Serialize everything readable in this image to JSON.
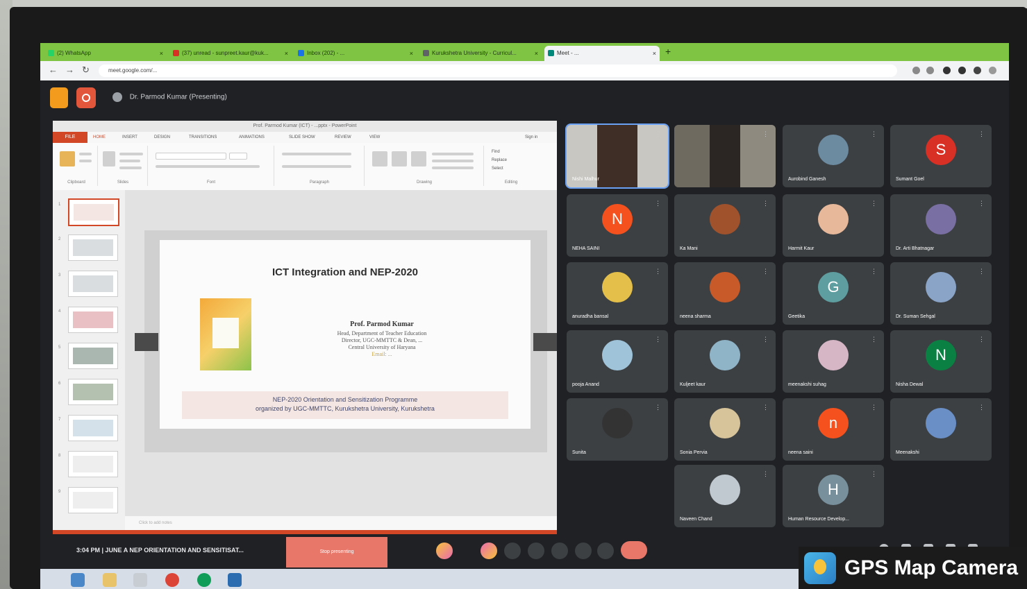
{
  "browser": {
    "tabs": [
      {
        "label": "(2) WhatsApp",
        "color": "#25d366"
      },
      {
        "label": "(37) unread - sunpreet.kaur@kuk...",
        "color": "#d93025"
      },
      {
        "label": "Inbox (202) - ...",
        "color": "#1a73e8"
      },
      {
        "label": "Kurukshetra University - Curricul...",
        "color": "#5f6368"
      },
      {
        "label": "Meet - ...",
        "color": "#00897b",
        "active": true
      }
    ],
    "new_tab": "+",
    "url": "meet.google.com/..."
  },
  "meet": {
    "presenter_label": "Dr. Parmod Kumar (Presenting)",
    "bottom_info": "3:04 PM  |  JUNE A NEP ORIENTATION AND SENSITISAT...",
    "present_now": "Stop presenting"
  },
  "powerpoint": {
    "window_title": "Prof. Parmod Kumar (ICT) - ...pptx - PowerPoint",
    "file_tab": "FILE",
    "tabs": [
      "HOME",
      "INSERT",
      "DESIGN",
      "TRANSITIONS",
      "ANIMATIONS",
      "SLIDE SHOW",
      "REVIEW",
      "VIEW"
    ],
    "sign_in": "Sign in",
    "ribbon_groups": [
      "Clipboard",
      "Slides",
      "Font",
      "Paragraph",
      "Drawing",
      "Editing"
    ],
    "ribbon_editing": [
      "Find",
      "Replace",
      "Select"
    ],
    "thumbnail_numbers": [
      "1",
      "2",
      "3",
      "4",
      "5",
      "6",
      "7",
      "8",
      "9"
    ],
    "notes_placeholder": "Click to add notes",
    "slide": {
      "title": "ICT Integration and NEP-2020",
      "speaker": "Prof. Parmod Kumar",
      "details": [
        "Head, Department of Teacher Education",
        "Director, UGC-MMTTC & Dean, ...",
        "Central University of Haryana",
        "Email: ..."
      ],
      "footer_line1": "NEP-2020 Orientation and Sensitization Programme",
      "footer_line2": "organized by UGC-MMTTC, Kurukshetra University, Kurukshetra"
    }
  },
  "participants": [
    {
      "name": "Nishi Malhur",
      "type": "video",
      "speaking": true
    },
    {
      "name": "",
      "type": "video"
    },
    {
      "name": "Aurobind Ganesh",
      "type": "photo",
      "color": "#6c8aa0"
    },
    {
      "name": "Sumant Goel",
      "type": "letter",
      "letter": "S",
      "color": "#d93025"
    },
    {
      "name": "NEHA SAINI",
      "type": "letter",
      "letter": "N",
      "color": "#f4511e"
    },
    {
      "name": "Ka Mani",
      "type": "photo",
      "color": "#a0522d"
    },
    {
      "name": "Harmit Kaur",
      "type": "photo",
      "color": "#e8b89a"
    },
    {
      "name": "Dr. Arti Bhatnagar",
      "type": "photo",
      "color": "#7a6fa3"
    },
    {
      "name": "anuradha bansal",
      "type": "photo",
      "color": "#e4c04a"
    },
    {
      "name": "neena sharma",
      "type": "photo",
      "color": "#c85a2a"
    },
    {
      "name": "Geetika",
      "type": "letter",
      "letter": "G",
      "color": "#5f9ea0"
    },
    {
      "name": "Dr. Suman Sehgal",
      "type": "photo",
      "color": "#8aa4c8"
    },
    {
      "name": "pooja Anand",
      "type": "photo",
      "color": "#9fc3d9"
    },
    {
      "name": "Kuljeet kaur",
      "type": "photo",
      "color": "#8fb3c7"
    },
    {
      "name": "meenakshi suhag",
      "type": "photo",
      "color": "#d6b5c4"
    },
    {
      "name": "Nisha Dewal",
      "type": "letter",
      "letter": "N",
      "color": "#0b8043"
    },
    {
      "name": "Sunita",
      "type": "photo",
      "color": "#333333"
    },
    {
      "name": "Sonia Pervia",
      "type": "photo",
      "color": "#d8c49a"
    },
    {
      "name": "neena saini",
      "type": "letter",
      "letter": "n",
      "color": "#f4511e"
    },
    {
      "name": "Meenakshi",
      "type": "photo",
      "color": "#6a8fc7"
    },
    {
      "name": "Naveen Chand",
      "type": "photo",
      "color": "#c0c8d0"
    },
    {
      "name": "Human Resource Develop...",
      "type": "letter",
      "letter": "H",
      "color": "#78909c"
    }
  ],
  "watermark": {
    "text": "GPS Map Camera"
  },
  "icons": {
    "back": "arrow-back-icon",
    "forward": "arrow-forward-icon",
    "reload": "reload-icon",
    "participant_menu": "more-vert-icon"
  }
}
